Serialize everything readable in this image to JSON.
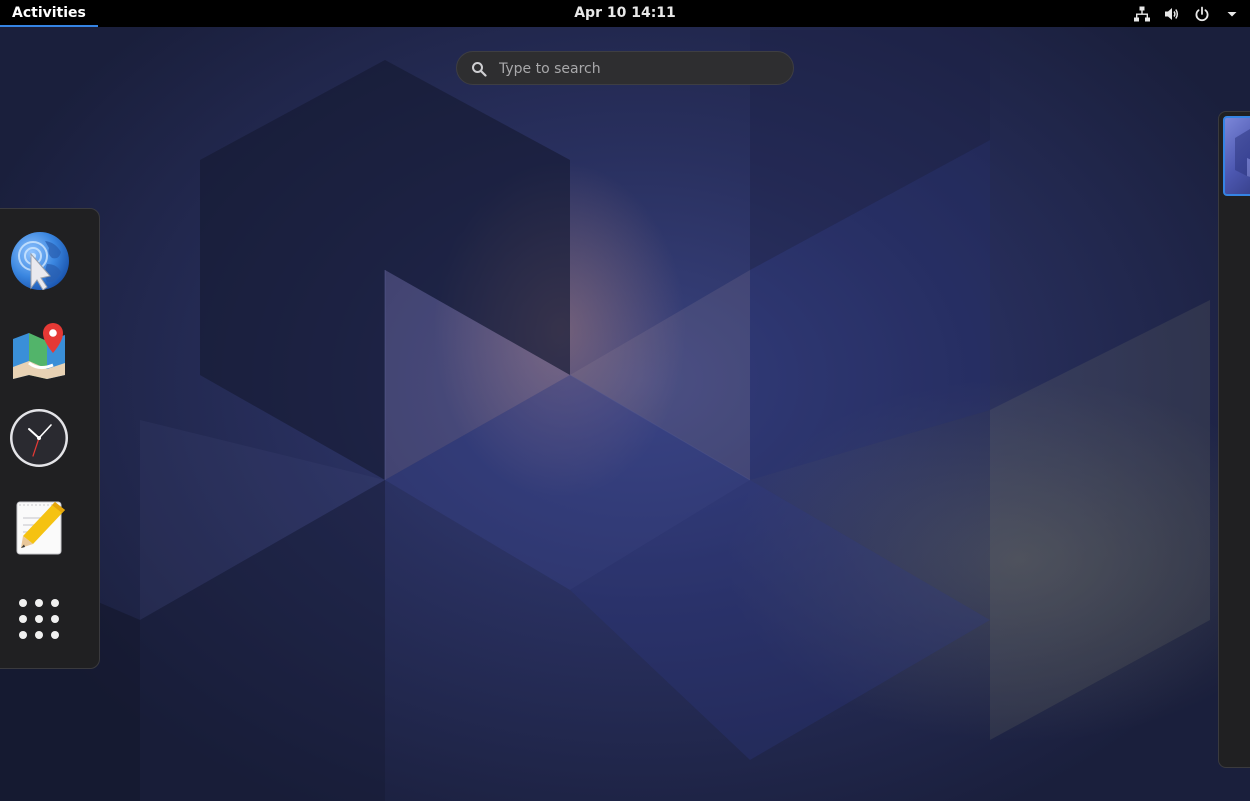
{
  "top_bar": {
    "activities_label": "Activities",
    "clock": "Apr 10  14:11",
    "tray": {
      "network_icon": "network-wired-icon",
      "volume_icon": "volume-high-icon",
      "power_icon": "power-icon",
      "menu_icon": "chevron-down-icon"
    }
  },
  "search": {
    "placeholder": "Type to search",
    "value": ""
  },
  "dash": {
    "items": [
      {
        "icon": "web-browser-icon"
      },
      {
        "icon": "maps-icon"
      },
      {
        "icon": "clocks-icon"
      },
      {
        "icon": "text-editor-icon"
      },
      {
        "icon": "show-apps-grid-icon"
      }
    ]
  },
  "workspace": {
    "active": 1
  },
  "colors": {
    "accent": "#3584e4",
    "top_bar": "#000000",
    "dash_background": "#202022",
    "map_pin": "#e53935",
    "clock_face": "#2a2a30"
  }
}
